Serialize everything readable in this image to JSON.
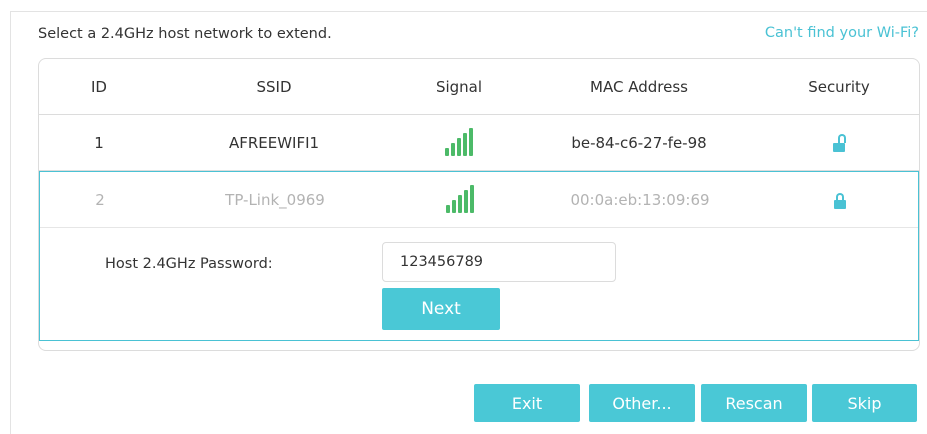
{
  "heading": "Select a 2.4GHz host network to extend.",
  "cant_find_link": "Can't find your Wi-Fi?",
  "table": {
    "columns": [
      "ID",
      "SSID",
      "Signal",
      "MAC Address",
      "Security"
    ],
    "rows": [
      {
        "id": "1",
        "ssid": "AFREEWIFI1",
        "signal_icon": "signal-strength-full-icon",
        "mac": "be-84-c6-27-fe-98",
        "security_icon": "unlocked-icon"
      },
      {
        "id": "2",
        "ssid": "TP-Link_0969",
        "signal_icon": "signal-strength-full-icon",
        "mac": "00:0a:eb:13:09:69",
        "security_icon": "locked-icon"
      }
    ]
  },
  "password": {
    "label": "Host 2.4GHz Password:",
    "value": "123456789"
  },
  "buttons": {
    "next": "Next",
    "exit": "Exit",
    "other": "Other...",
    "rescan": "Rescan",
    "skip": "Skip"
  },
  "colors": {
    "accent": "#4ac8d6",
    "link": "#4ac2d4",
    "signal": "#4cba68"
  }
}
